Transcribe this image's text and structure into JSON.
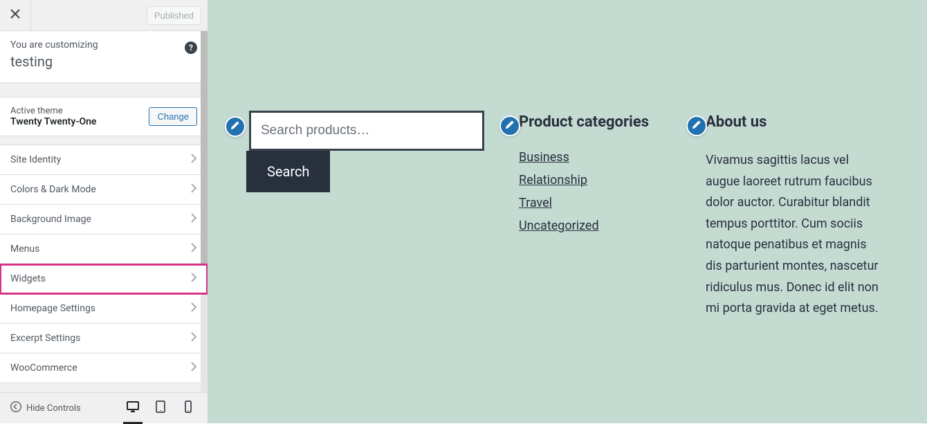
{
  "header": {
    "published_label": "Published"
  },
  "intro": {
    "label": "You are customizing",
    "site_name": "testing"
  },
  "theme": {
    "label": "Active theme",
    "name": "Twenty Twenty-One",
    "change_label": "Change"
  },
  "menu_items": [
    {
      "label": "Site Identity",
      "highlighted": false
    },
    {
      "label": "Colors & Dark Mode",
      "highlighted": false
    },
    {
      "label": "Background Image",
      "highlighted": false
    },
    {
      "label": "Menus",
      "highlighted": false
    },
    {
      "label": "Widgets",
      "highlighted": true
    },
    {
      "label": "Homepage Settings",
      "highlighted": false
    },
    {
      "label": "Excerpt Settings",
      "highlighted": false
    },
    {
      "label": "WooCommerce",
      "highlighted": false
    }
  ],
  "footer": {
    "hide_controls_label": "Hide Controls"
  },
  "preview": {
    "search": {
      "placeholder": "Search products…",
      "button_label": "Search"
    },
    "categories": {
      "title": "Product categories",
      "items": [
        "Business",
        "Relationship",
        "Travel",
        "Uncategorized"
      ]
    },
    "about": {
      "title": "About us",
      "text": "Vivamus sagittis lacus vel augue laoreet rutrum faucibus dolor auctor. Curabitur blandit tempus porttitor. Cum sociis natoque penatibus et magnis dis parturient montes, nascetur ridiculus mus. Donec id elit non mi porta gravida at eget metus."
    }
  },
  "colors": {
    "accent": "#2271b1",
    "highlight": "#d63384",
    "preview_bg": "#c4dbd2",
    "dark": "#28303d"
  }
}
